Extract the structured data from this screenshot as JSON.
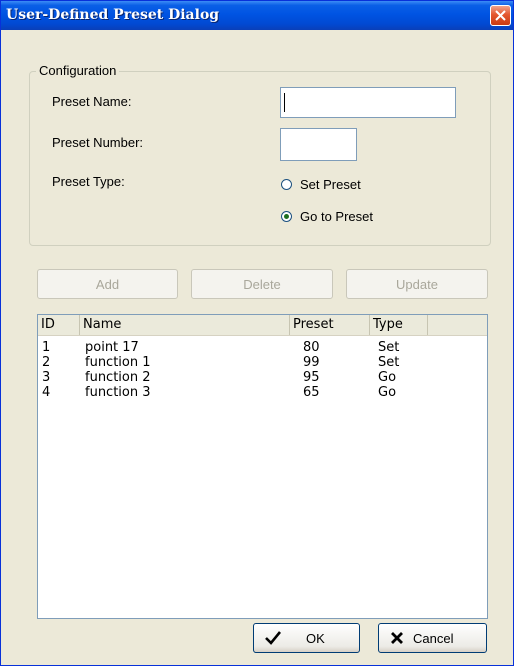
{
  "window": {
    "title": "User-Defined Preset Dialog"
  },
  "config": {
    "legend": "Configuration",
    "preset_name_label": "Preset Name:",
    "preset_name_value": "",
    "preset_number_label": "Preset Number:",
    "preset_number_value": "",
    "preset_type_label": "Preset Type:",
    "radio_set": "Set Preset",
    "radio_goto": "Go to Preset",
    "selected_type": "Go to Preset"
  },
  "actions": {
    "add": "Add",
    "delete": "Delete",
    "update": "Update"
  },
  "list": {
    "columns": [
      "ID",
      "Name",
      "Preset",
      "Type"
    ],
    "rows": [
      {
        "id": "1",
        "name": "point 17",
        "preset": "80",
        "type": "Set"
      },
      {
        "id": "2",
        "name": "function 1",
        "preset": "99",
        "type": "Set"
      },
      {
        "id": "3",
        "name": "function 2",
        "preset": "95",
        "type": "Go"
      },
      {
        "id": "4",
        "name": "function 3",
        "preset": "65",
        "type": "Go"
      }
    ]
  },
  "footer": {
    "ok": "OK",
    "cancel": "Cancel"
  },
  "icons": {
    "close": "close-icon",
    "ok": "checkmark-icon",
    "cancel": "x-icon"
  }
}
